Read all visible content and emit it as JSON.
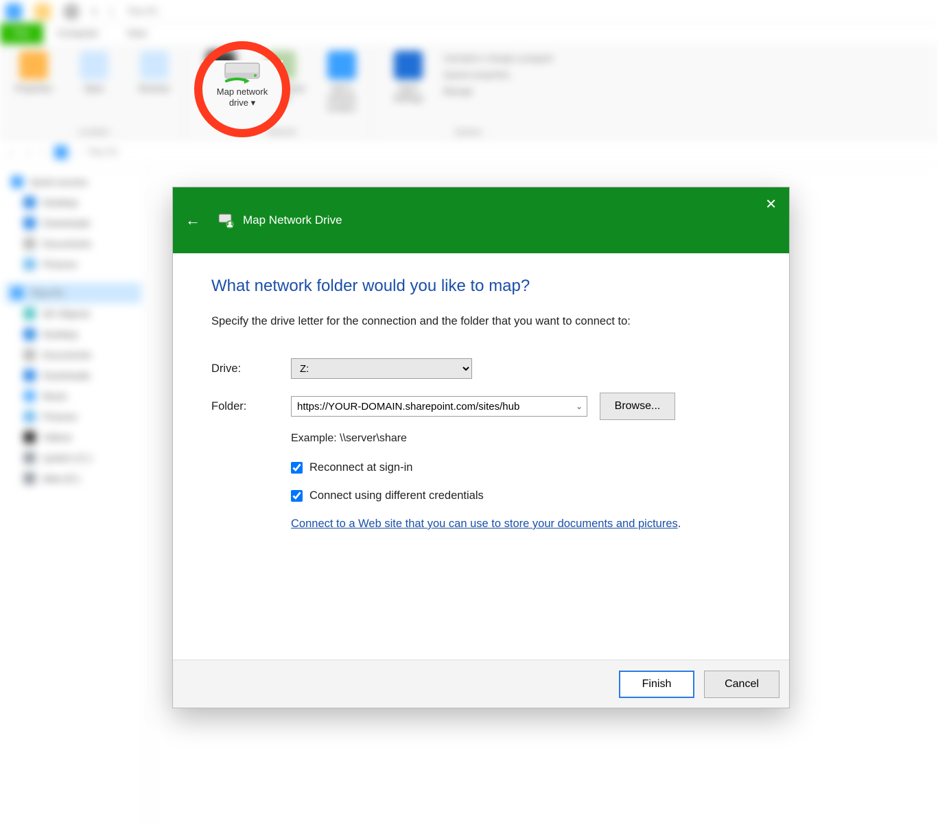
{
  "window": {
    "title": "This PC"
  },
  "tabs": [
    "File",
    "Computer",
    "View"
  ],
  "ribbon": {
    "groups": [
      {
        "label": "Location",
        "items": [
          "Properties",
          "Open",
          "Rename"
        ]
      },
      {
        "label": "Network",
        "items": [
          "Access media",
          "Map network drive",
          "Add a network location"
        ]
      },
      {
        "label": "System",
        "items": [
          "Open Settings"
        ],
        "side": [
          "Uninstall or change a program",
          "System properties",
          "Manage"
        ]
      }
    ],
    "highlighted_button": "Map network\ndrive ▾"
  },
  "path": "This PC",
  "tree": {
    "quick_access": "Quick access",
    "items": [
      "Desktop",
      "Downloads",
      "Documents",
      "Pictures"
    ],
    "this_pc": "This PC",
    "pc_items": [
      "3D Objects",
      "Desktop",
      "Documents",
      "Downloads",
      "Music",
      "Pictures",
      "Videos",
      "system (C:)",
      "data (D:)"
    ]
  },
  "dialog": {
    "title": "Map Network Drive",
    "heading": "What network folder would you like to map?",
    "description": "Specify the drive letter for the connection and the folder that you want to connect to:",
    "drive_label": "Drive:",
    "drive_value": "Z:",
    "folder_label": "Folder:",
    "folder_value": "https://YOUR-DOMAIN.sharepoint.com/sites/hub",
    "browse": "Browse...",
    "example": "Example: \\\\server\\share",
    "reconnect": "Reconnect at sign-in",
    "credentials": "Connect using different credentials",
    "link": "Connect to a Web site that you can use to store your documents and pictures",
    "finish": "Finish",
    "cancel": "Cancel"
  }
}
